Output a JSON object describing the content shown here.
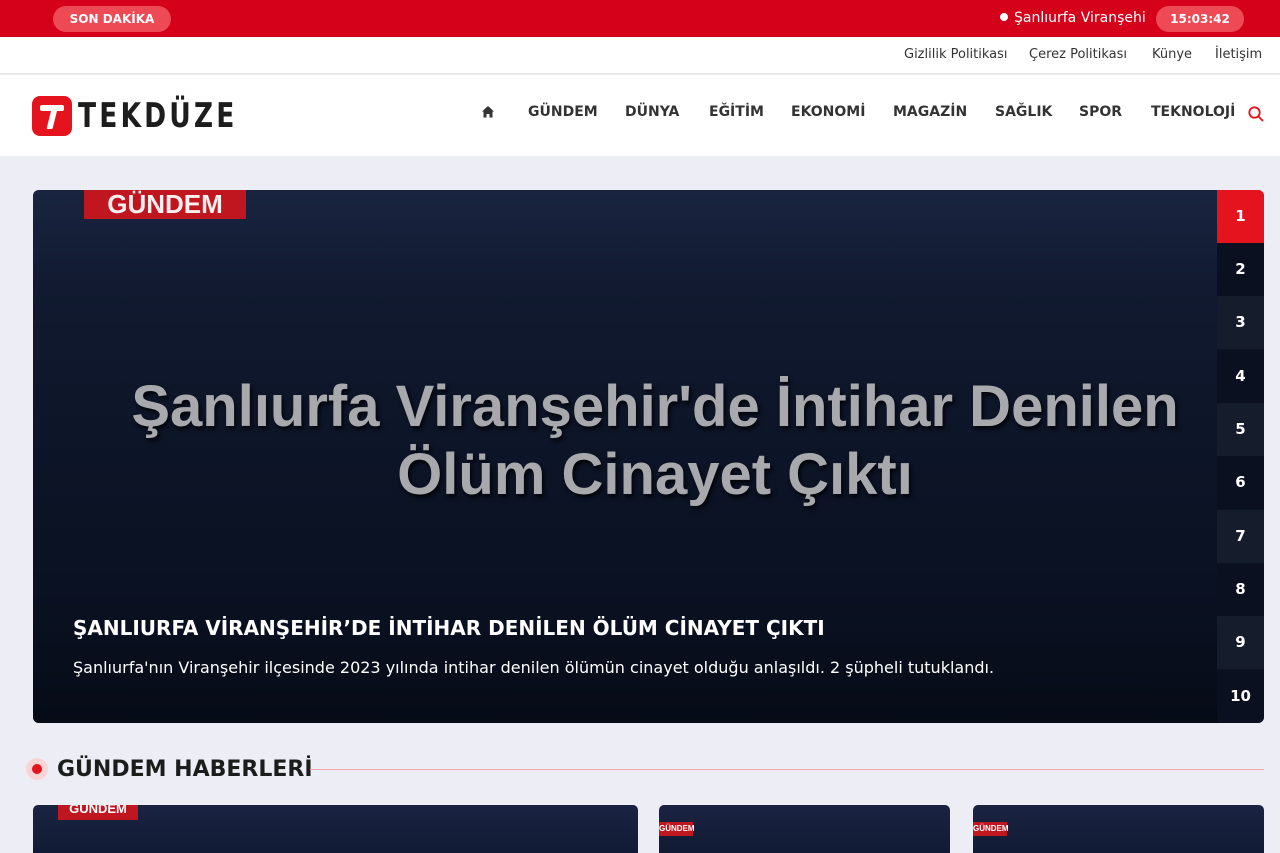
{
  "topbar": {
    "son_dakika": "SON DAKİKA",
    "ticker_text": "Şanlıurfa Viranşehir'de İntihar Denilen Ölüm Cinayet Çıktı",
    "clock": "15:03:42"
  },
  "utility_links": [
    "Gizlilik Politikası",
    "Çerez Politikası",
    "Künye",
    "İletişim"
  ],
  "logo": {
    "text": "TEKDÜZE"
  },
  "nav": {
    "items": [
      "GÜNDEM",
      "DÜNYA",
      "EĞİTİM",
      "EKONOMİ",
      "MAGAZİN",
      "SAĞLIK",
      "SPOR",
      "TEKNOLOJİ"
    ]
  },
  "slider": {
    "category": "GÜNDEM",
    "image_text": "Şanlıurfa Viranşehir'de İntihar Denilen Ölüm Cinayet Çıktı",
    "headline": "ŞANLIURFA VİRANŞEHİR’DE İNTİHAR DENİLEN ÖLÜM CİNAYET ÇIKTI",
    "summary": "Şanlıurfa'nın Viranşehir ilçesinde 2023 yılında intihar denilen ölümün cinayet olduğu anlaşıldı. 2 şüpheli tutuklandı.",
    "pages": [
      "1",
      "2",
      "3",
      "4",
      "5",
      "6",
      "7",
      "8",
      "9",
      "10"
    ],
    "active_page": "1"
  },
  "section": {
    "title": "GÜNDEM HABERLERİ"
  },
  "cards": [
    {
      "category": "GÜNDEM"
    },
    {
      "category": "GÜNDEM"
    },
    {
      "category": "GÜNDEM"
    }
  ],
  "colors": {
    "brand_red": "#d5001a",
    "active_red": "#e5131d"
  }
}
